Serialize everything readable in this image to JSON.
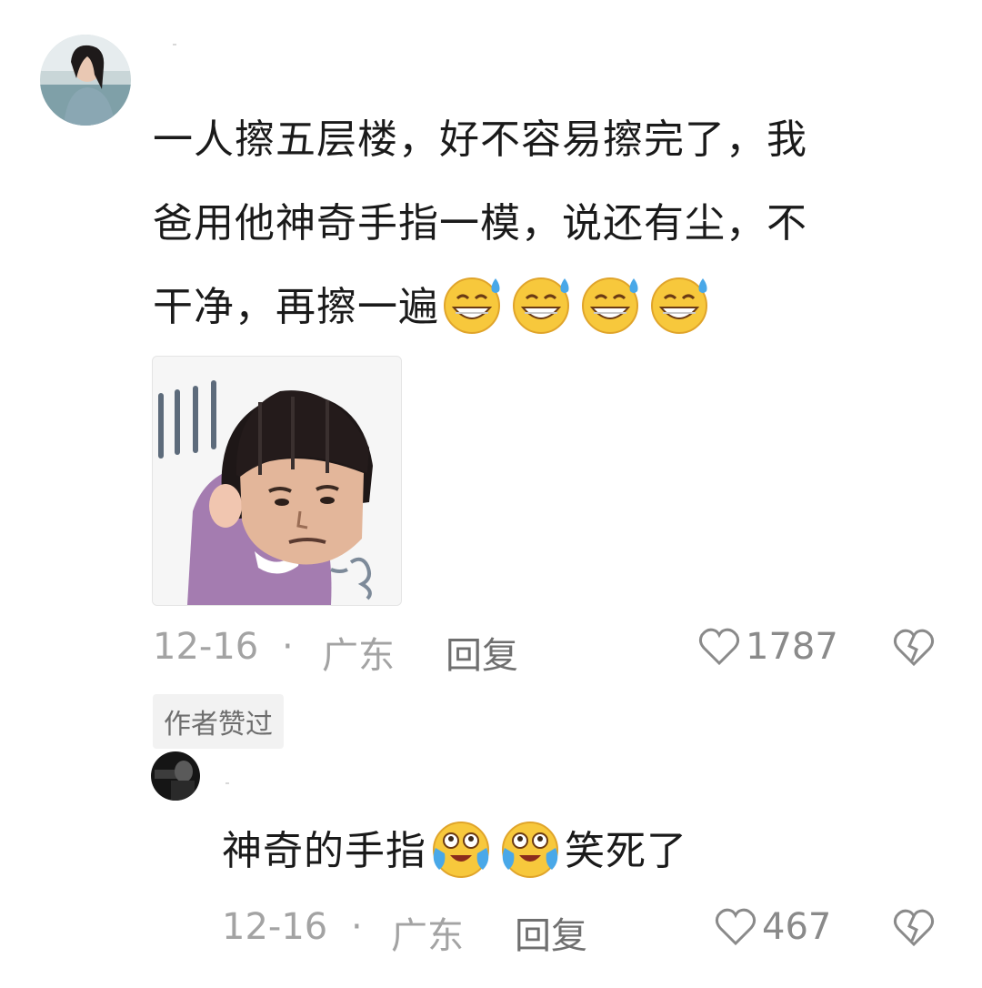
{
  "comment": {
    "text_lines": [
      "一人擦五层楼，好不容易擦完了，我",
      "爸用他神奇手指一模，说还有尘，不",
      "干净，再擦一遍"
    ],
    "emojis": [
      "grin-sweat-emoji",
      "grin-sweat-emoji",
      "grin-sweat-emoji",
      "grin-sweat-emoji"
    ],
    "date": "12-16",
    "separator": "·",
    "location": "广东",
    "reply_label": "回复",
    "like_count": "1787",
    "author_liked_badge": "作者赞过"
  },
  "reply": {
    "text_before": "神奇的手指",
    "emojis": [
      "crying-laugh-emoji",
      "crying-laugh-emoji"
    ],
    "text_after": "笑死了",
    "date": "12-16",
    "separator": "·",
    "location": "广东",
    "reply_label": "回复",
    "like_count": "467"
  },
  "colors": {
    "meta_gray": "#a3a3a3",
    "badge_bg": "#f2f2f2",
    "sticker_sweater": "#a47cb0"
  }
}
